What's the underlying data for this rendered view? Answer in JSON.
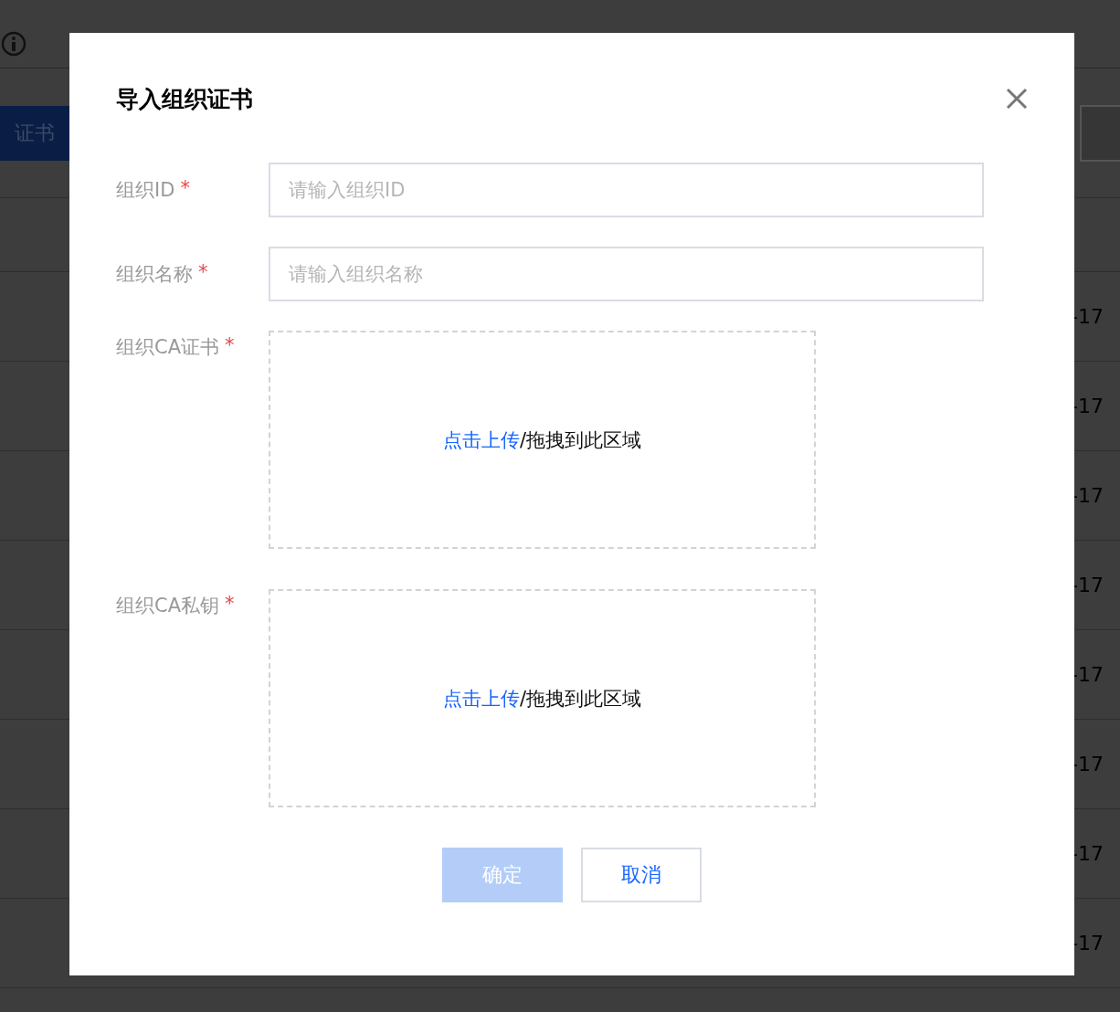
{
  "background": {
    "tab_button": "证书",
    "table_rows": [
      "-17",
      "-17",
      "-17",
      "-17",
      "-17",
      "-17",
      "-17",
      "-17"
    ]
  },
  "dialog": {
    "title": "导入组织证书",
    "fields": [
      {
        "kind": "input",
        "label": "组织ID",
        "required_mark": "*",
        "placeholder": "请输入组织ID"
      },
      {
        "kind": "input",
        "label": "组织名称",
        "required_mark": "*",
        "placeholder": "请输入组织名称"
      },
      {
        "kind": "upload",
        "label": "组织CA证书",
        "required_mark": "*",
        "link": "点击上传",
        "hint": "/拖拽到此区域"
      },
      {
        "kind": "upload",
        "label": "组织CA私钥",
        "required_mark": "*",
        "link": "点击上传",
        "hint": "/拖拽到此区域"
      }
    ],
    "buttons": [
      {
        "label": "确定",
        "kind": "primary",
        "disabled": true
      },
      {
        "label": "取消",
        "kind": "secondary",
        "disabled": false
      }
    ]
  }
}
